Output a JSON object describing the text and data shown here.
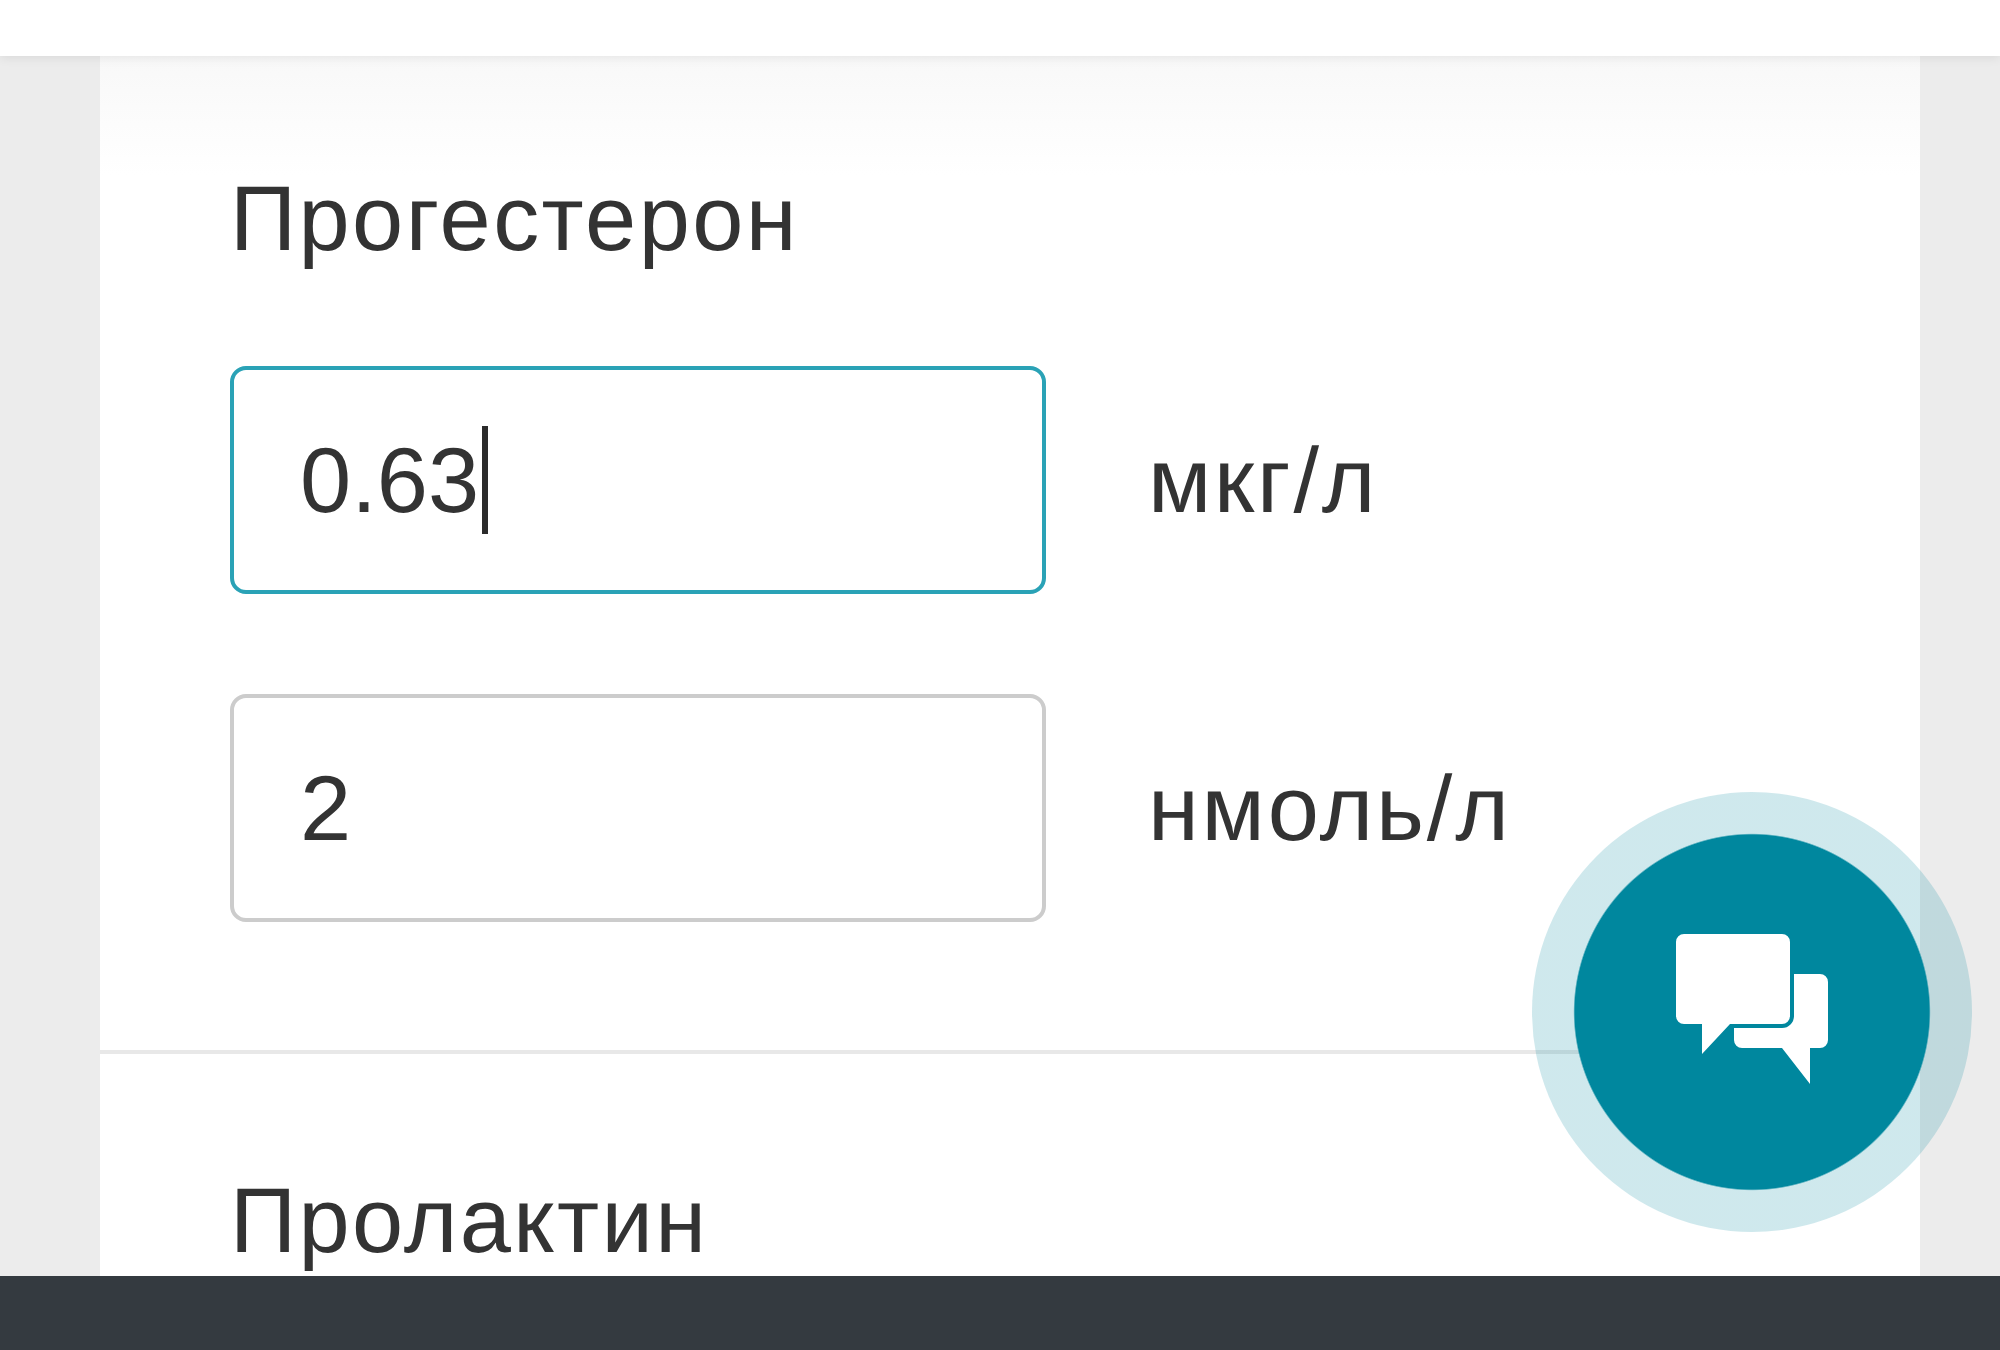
{
  "sections": [
    {
      "title": "Прогестерон",
      "fields": [
        {
          "value": "0.63",
          "unit": "мкг/л",
          "focused": true
        },
        {
          "value": "2",
          "unit": "нмоль/л",
          "focused": false
        }
      ]
    },
    {
      "title": "Пролактин"
    }
  ]
}
